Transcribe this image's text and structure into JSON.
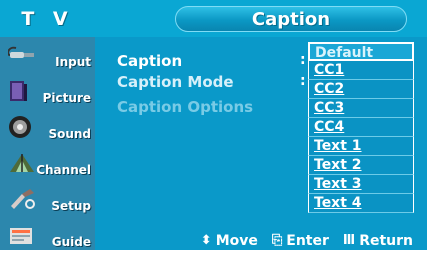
{
  "header": {
    "section_label": "T V",
    "title": "Caption"
  },
  "sidebar": {
    "items": [
      {
        "label": "Input",
        "icon": "input-cable-icon"
      },
      {
        "label": "Picture",
        "icon": "picture-icon"
      },
      {
        "label": "Sound",
        "icon": "speaker-icon"
      },
      {
        "label": "Channel",
        "icon": "antenna-icon"
      },
      {
        "label": "Setup",
        "icon": "setup-tools-icon"
      },
      {
        "label": "Guide",
        "icon": "guide-icon"
      }
    ]
  },
  "menu": {
    "caption_label": "Caption",
    "caption_mode_label": "Caption Mode",
    "caption_options_label": "Caption Options",
    "colon": ":"
  },
  "caption_options": {
    "selected": "Default",
    "items": [
      "Default",
      "CC1",
      "CC2",
      "CC3",
      "CC4",
      "Text 1",
      "Text 2",
      "Text 3",
      "Text 4"
    ]
  },
  "footer": {
    "move_label": "Move",
    "enter_label": "Enter",
    "return_label": "Return",
    "move_icon": "up-down-arrow-icon",
    "enter_icon": "enter-icon",
    "return_icon": "return-icon"
  },
  "colors": {
    "panel": "#0a99c9",
    "topbar": "#0aa7d3",
    "sidebar": "#2c87ad"
  }
}
